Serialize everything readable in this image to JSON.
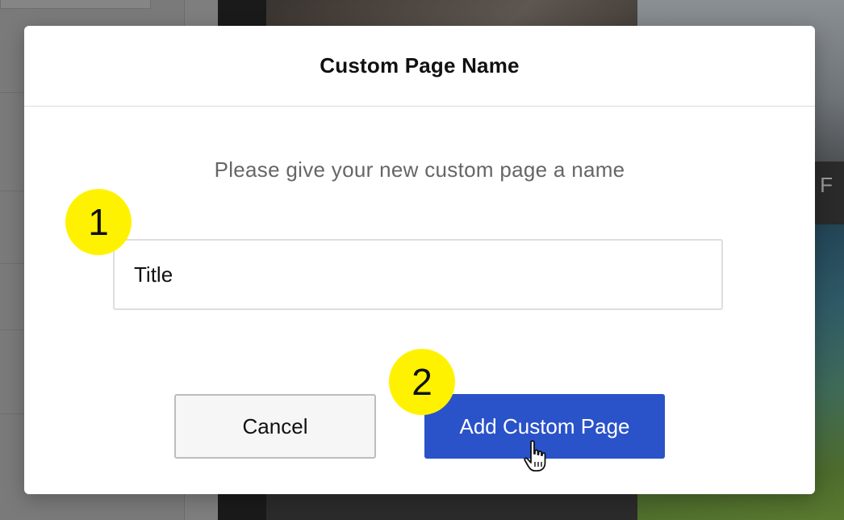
{
  "background": {
    "partial_text": "ng F"
  },
  "modal": {
    "title": "Custom Page Name",
    "subtitle": "Please give your new custom page a name",
    "input": {
      "value": "Title",
      "placeholder": ""
    },
    "cancel_label": "Cancel",
    "submit_label": "Add Custom Page"
  },
  "annotations": {
    "step_1": "1",
    "step_2": "2"
  },
  "colors": {
    "primary_button": "#2a52c9",
    "badge": "#fff200"
  },
  "icons": {
    "cursor": "hand-pointer-icon"
  }
}
